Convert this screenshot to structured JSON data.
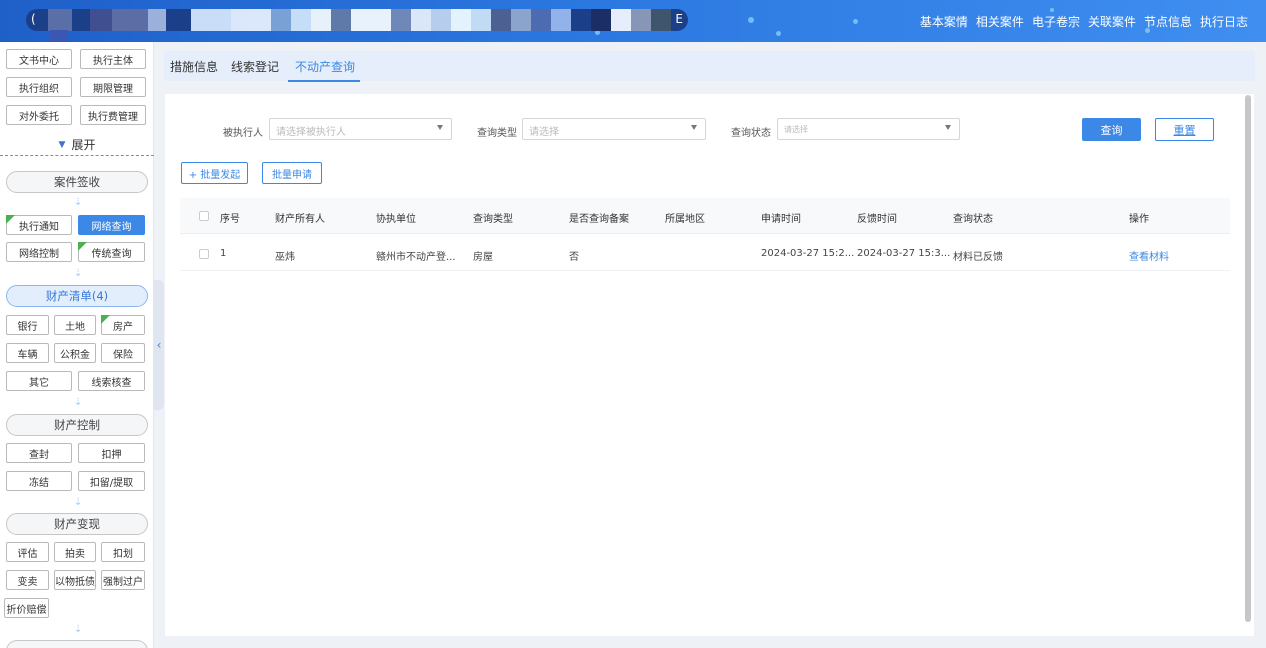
{
  "header": {
    "case_title_prefix": "(",
    "case_title_suffix": "E",
    "nav": [
      "基本案情",
      "相关案件",
      "电子卷宗",
      "关联案件",
      "节点信息",
      "执行日志"
    ]
  },
  "sidebar": {
    "top_buttons": [
      "文书中心",
      "执行主体",
      "执行组织",
      "期限管理",
      "对外委托",
      "执行费管理"
    ],
    "expand_label": "展开",
    "sections": [
      {
        "title": "案件签收",
        "items": [
          {
            "label": "执行通知",
            "done": true
          },
          {
            "label": "网络查询",
            "active": true
          },
          {
            "label": "网络控制"
          },
          {
            "label": "传统查询",
            "done": true
          }
        ]
      },
      {
        "title": "财产清单(4)",
        "highlighted": true,
        "items": [
          {
            "label": "银行"
          },
          {
            "label": "土地"
          },
          {
            "label": "房产",
            "done": true
          },
          {
            "label": "车辆"
          },
          {
            "label": "公积金"
          },
          {
            "label": "保险"
          },
          {
            "label": "其它"
          },
          {
            "label": "线索核查"
          }
        ]
      },
      {
        "title": "财产控制",
        "items": [
          {
            "label": "查封"
          },
          {
            "label": "扣押"
          },
          {
            "label": "冻结"
          },
          {
            "label": "扣留/提取"
          }
        ]
      },
      {
        "title": "财产变现",
        "items": [
          {
            "label": "评估"
          },
          {
            "label": "拍卖"
          },
          {
            "label": "扣划"
          },
          {
            "label": "变卖"
          },
          {
            "label": "以物抵债"
          },
          {
            "label": "强制过户"
          },
          {
            "label": "折价赔偿"
          }
        ]
      }
    ]
  },
  "tabs": {
    "items": [
      "措施信息",
      "线索登记",
      "不动产查询"
    ],
    "active_index": 2
  },
  "filters": {
    "executee": {
      "label": "被执行人",
      "placeholder": "请选择被执行人"
    },
    "query_type": {
      "label": "查询类型",
      "placeholder": "请选择"
    },
    "query_status": {
      "label": "查询状态",
      "placeholder": "请选择"
    },
    "search_label": "查询",
    "reset_label": "重置"
  },
  "actions": {
    "batch_launch": "+ 批量发起",
    "batch_apply": "批量申请"
  },
  "table": {
    "columns": [
      "序号",
      "财产所有人",
      "协执单位",
      "查询类型",
      "是否查询备案",
      "所属地区",
      "申请时间",
      "反馈时间",
      "查询状态",
      "操作"
    ],
    "rows": [
      {
        "index": "1",
        "owner": "巫炜",
        "unit": "赣州市不动产登...",
        "type": "房屋",
        "filed": "否",
        "region": "",
        "apply_time": "2024-03-27 15:2...",
        "feedback_time": "2024-03-27 15:3...",
        "status": "材料已反馈",
        "action": "查看材料"
      }
    ]
  },
  "colors": {
    "primary": "#3c88e6",
    "done_marker": "#4caf50",
    "header_start": "#1f5fc8",
    "header_end": "#3f8ef0"
  }
}
